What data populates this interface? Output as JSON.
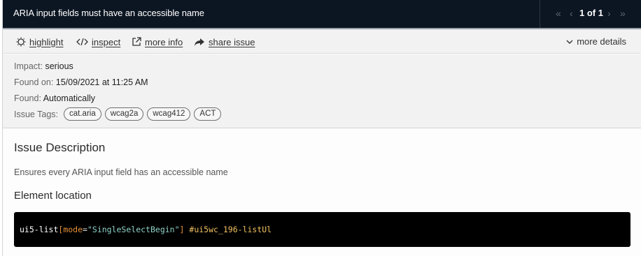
{
  "header": {
    "title": "ARIA input fields must have an accessible name",
    "pager": {
      "current": 1,
      "total": 1,
      "text": "1 of 1"
    }
  },
  "toolbar": {
    "highlight": "highlight",
    "inspect": "inspect",
    "more_info": "more info",
    "share_issue": "share issue",
    "more_details": "more details"
  },
  "meta": {
    "impact_label": "Impact:",
    "impact_value": "serious",
    "found_on_label": "Found on:",
    "found_on_value": "15/09/2021 at 11:25 AM",
    "found_label": "Found:",
    "found_value": "Automatically",
    "tags_label": "Issue Tags:",
    "tags": [
      "cat.aria",
      "wcag2a",
      "wcag412",
      "ACT"
    ]
  },
  "description": {
    "title": "Issue Description",
    "text": "Ensures every ARIA input field has an accessible name",
    "location_title": "Element location"
  },
  "code": {
    "tag": "ui5-list",
    "open_bracket": "[",
    "attr": "mode",
    "eq": "=",
    "value": "\"SingleSelectBegin\"",
    "close_bracket": "]",
    "space": " ",
    "id": "#ui5wc_196-listUl"
  },
  "colors": {
    "header_bg": "#0c1622",
    "panel_bg": "#f2f2f2",
    "code_bg": "#000000",
    "code_attr": "#e69138",
    "code_string": "#8fd3c8",
    "code_id": "#f0c060"
  },
  "icons": {
    "highlight": "sun-icon",
    "inspect": "code-icon",
    "more_info": "external-link-icon",
    "share_issue": "share-icon",
    "more_details": "chevron-down-icon",
    "pager": [
      "first-page-icon",
      "prev-page-icon",
      "next-page-icon",
      "last-page-icon"
    ]
  }
}
